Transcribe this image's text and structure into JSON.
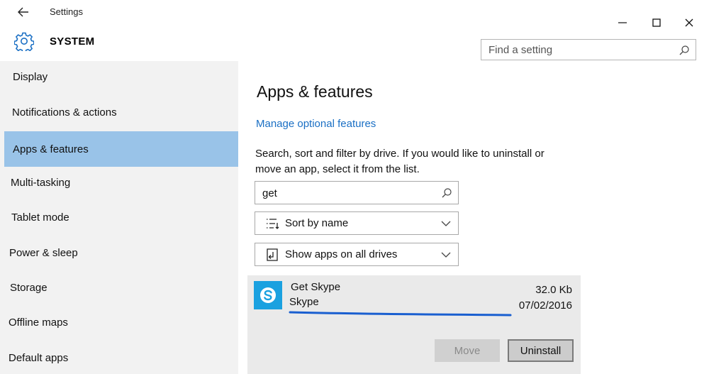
{
  "window": {
    "title": "Settings"
  },
  "header": {
    "section": "SYSTEM",
    "search_placeholder": "Find a setting"
  },
  "sidebar": {
    "items": [
      {
        "label": "Display",
        "active": false
      },
      {
        "label": "Notifications & actions",
        "active": false
      },
      {
        "label": "Apps & features",
        "active": true
      },
      {
        "label": "Multi-tasking",
        "active": false
      },
      {
        "label": "Tablet mode",
        "active": false
      },
      {
        "label": "Power & sleep",
        "active": false
      },
      {
        "label": "Storage",
        "active": false
      },
      {
        "label": "Offline maps",
        "active": false
      },
      {
        "label": "Default apps",
        "active": false
      }
    ]
  },
  "main": {
    "title": "Apps & features",
    "manage_link": "Manage optional features",
    "description": "Search, sort and filter by drive. If you would like to uninstall or move an app, select it from the list.",
    "search_value": "get",
    "sort_label": "Sort by name",
    "filter_label": "Show apps on all drives",
    "app": {
      "name": "Get Skype",
      "publisher": "Skype",
      "size": "32.0 Kb",
      "date": "07/02/2016",
      "move_label": "Move",
      "uninstall_label": "Uninstall"
    }
  },
  "colors": {
    "accent": "#1a6fc4",
    "active_nav": "#99c3e8",
    "skype_blue": "#1aa1e0",
    "highlight_stroke": "#1a5fd0"
  },
  "icons": {
    "back": "back-arrow-icon",
    "gear": "gear-icon",
    "search": "search-icon",
    "sort": "sort-list-icon",
    "drives": "drive-icon",
    "chevron": "chevron-down-icon",
    "skype": "skype-icon"
  }
}
